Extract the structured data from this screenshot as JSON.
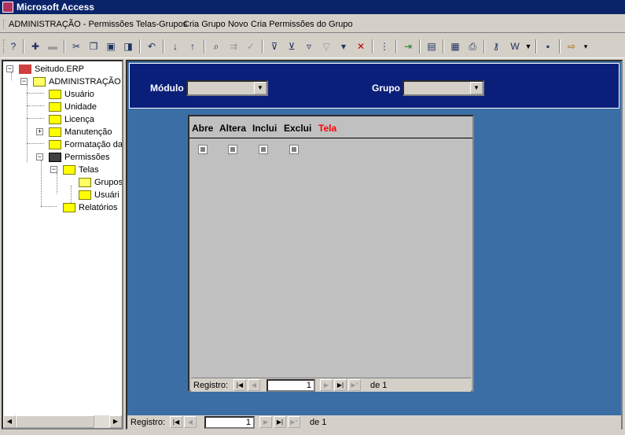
{
  "app": {
    "title": "Microsoft Access"
  },
  "menu": {
    "items": [
      "ADMINISTRAÇÃO - Permissões Telas-Grupos",
      "Cria Grupo Novo",
      "Cria Permissões do Grupo"
    ]
  },
  "toolbar": {
    "icons": [
      "help-icon",
      "new-record-icon",
      "delete-record-icon",
      "cut-icon",
      "copy-icon",
      "paste-icon",
      "format-painter-icon",
      "undo-icon",
      "sort-ascending-icon",
      "sort-descending-icon",
      "find-icon",
      "find-next-icon",
      "spelling-icon",
      "filter-by-selection-icon",
      "filter-by-form-icon",
      "apply-filter-icon",
      "remove-filter-icon",
      "advanced-filter-icon",
      "clear-filter-icon",
      "object-list-icon",
      "import-icon",
      "properties-icon",
      "database-window-icon",
      "print-icon",
      "key-icon",
      "word-icon",
      "save-icon",
      "exit-icon"
    ]
  },
  "tree": {
    "root": "Seitudo.ERP",
    "admin": "ADMINISTRAÇÃO",
    "items": [
      "Usuário",
      "Unidade",
      "Licença",
      "Manutenção",
      "Formatação da"
    ],
    "permissoes": "Permissões",
    "telas": "Telas",
    "telas_items": [
      "Grupos",
      "Usuári"
    ],
    "relatorios": "Relatórios"
  },
  "form": {
    "modulo_label": "Módulo",
    "modulo_value": "",
    "grupo_label": "Grupo",
    "grupo_value": ""
  },
  "subform": {
    "columns": [
      "Abre",
      "Altera",
      "Inclui",
      "Exclui",
      "Tela"
    ],
    "rows": [
      {
        "abre": null,
        "altera": null,
        "inclui": null,
        "exclui": null,
        "tela": ""
      }
    ]
  },
  "subnav": {
    "label": "Registro:",
    "current": "1",
    "of": "de 1"
  },
  "mainnav": {
    "label": "Registro:",
    "current": "1",
    "of": "de 1"
  },
  "colors": {
    "title_bg": "#0a246a",
    "header_bg": "#0a1f7a",
    "detail_bg": "#3a6ea5",
    "subform_bg": "#c0c0c0",
    "tela_header": "#ff0000"
  }
}
